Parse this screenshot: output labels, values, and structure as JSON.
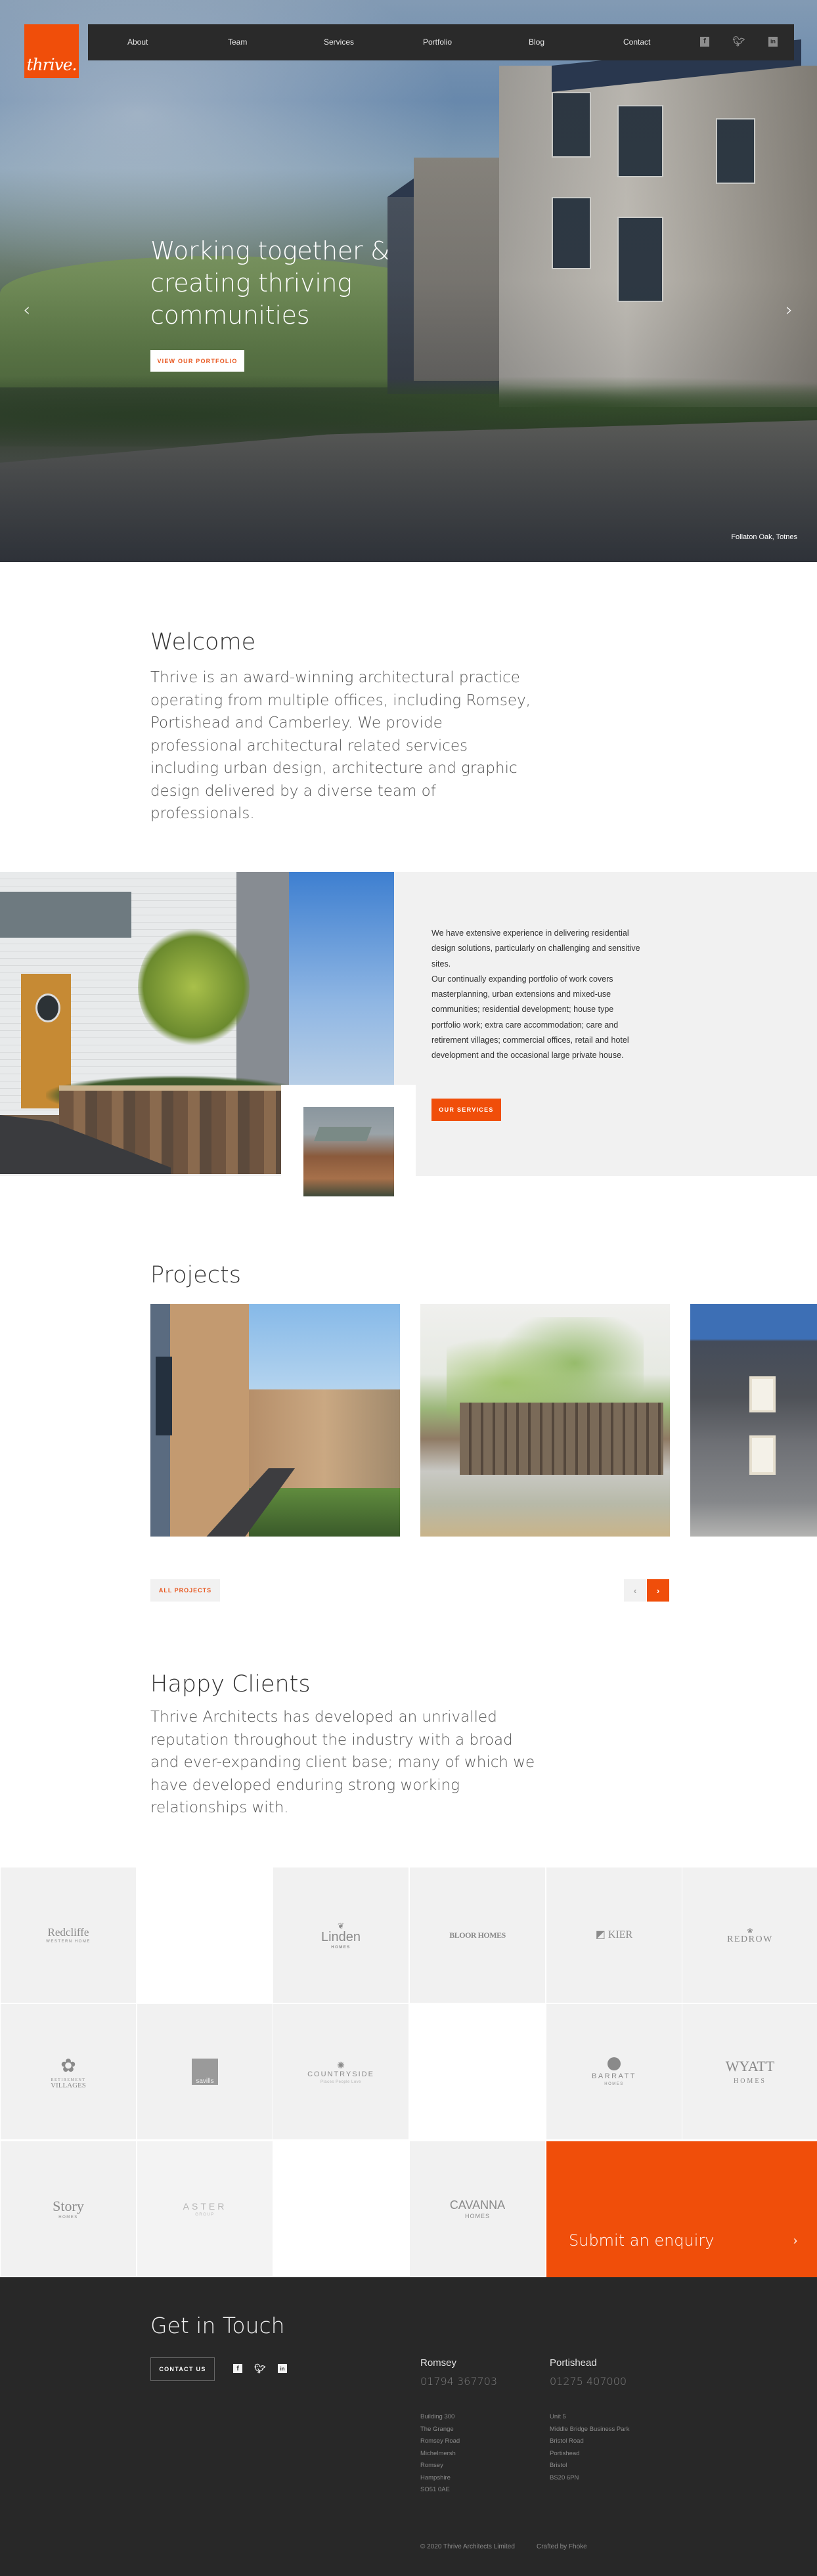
{
  "brand": {
    "logo_text": "thrive.",
    "accent": "#f04e0a",
    "dark": "#2a2a2a"
  },
  "nav": {
    "items": [
      "About",
      "Team",
      "Services",
      "Portfolio",
      "Blog",
      "Contact"
    ],
    "social": [
      "facebook-icon",
      "twitter-icon",
      "linkedin-icon"
    ]
  },
  "hero": {
    "title_lines": [
      "Working together &",
      "creating thriving",
      "communities"
    ],
    "button": "VIEW OUR PORTFOLIO",
    "prev_arrow": "‹",
    "next_arrow": "›",
    "caption": "Follaton Oak, Totnes"
  },
  "welcome": {
    "title": "Welcome",
    "text": "Thrive is an award-winning architectural practice operating from multiple offices, including Romsey, Portishead and Camberley. We provide professional architectural related services including urban design, architecture and graphic design delivered by a diverse team of professionals."
  },
  "services": {
    "paragraph1": "We have extensive experience in delivering residential design solutions, particularly on challenging and sensitive sites.",
    "paragraph2": "Our continually expanding portfolio of work covers masterplanning, urban extensions and mixed-use communities; residential development; house type portfolio work; extra care accommodation; care and retirement villages; commercial offices, retail and hotel development and the occasional large private house.",
    "button": "OUR SERVICES"
  },
  "projects": {
    "title": "Projects",
    "all_button": "ALL PROJECTS",
    "prev": "‹",
    "next": "›"
  },
  "clients": {
    "title": "Happy Clients",
    "text": "Thrive Architects has developed an unrivalled reputation throughout the industry with a broad and ever-expanding client base; many of which we have developed enduring strong working relationships with.",
    "logos": [
      {
        "name": "Redcliffe",
        "sub": "WESTERN HOME"
      },
      {
        "name": "",
        "sub": ""
      },
      {
        "name": "Linden",
        "sub": "HOMES"
      },
      {
        "name": "BLOOR HOMES",
        "sub": ""
      },
      {
        "name": "KIER",
        "sub": ""
      },
      {
        "name": "REDROW",
        "sub": ""
      },
      {
        "name": "VILLAGES",
        "sub": "RETIREMENT"
      },
      {
        "name": "savills",
        "sub": ""
      },
      {
        "name": "COUNTRYSIDE",
        "sub": "Places People Love"
      },
      {
        "name": "",
        "sub": ""
      },
      {
        "name": "BARRATT",
        "sub": "HOMES"
      },
      {
        "name": "WYATT",
        "sub": "HOMES"
      },
      {
        "name": "Story",
        "sub": "HOMES"
      },
      {
        "name": "ASTER",
        "sub": "GROUP"
      },
      {
        "name": "",
        "sub": ""
      },
      {
        "name": "CAVANNA",
        "sub": "HOMES"
      }
    ],
    "enquiry": "Submit an enquiry",
    "enquiry_arrow": "›"
  },
  "footer": {
    "title": "Get in Touch",
    "contact_button": "CONTACT US",
    "offices": [
      {
        "city": "Romsey",
        "phone": "01794 367703",
        "address": [
          "Building 300",
          "The Grange",
          "Romsey Road",
          "Michelmersh",
          "Romsey",
          "Hampshire",
          "SO51 0AE"
        ]
      },
      {
        "city": "Portishead",
        "phone": "01275 407000",
        "address": [
          "Unit 5",
          "Middle Bridge Business Park",
          "Bristol Road",
          "Portishead",
          "Bristol",
          "BS20 6PN"
        ]
      }
    ],
    "copyright": "© 2020 Thrive Architects Limited",
    "crafted": "Crafted by Fhoke"
  }
}
